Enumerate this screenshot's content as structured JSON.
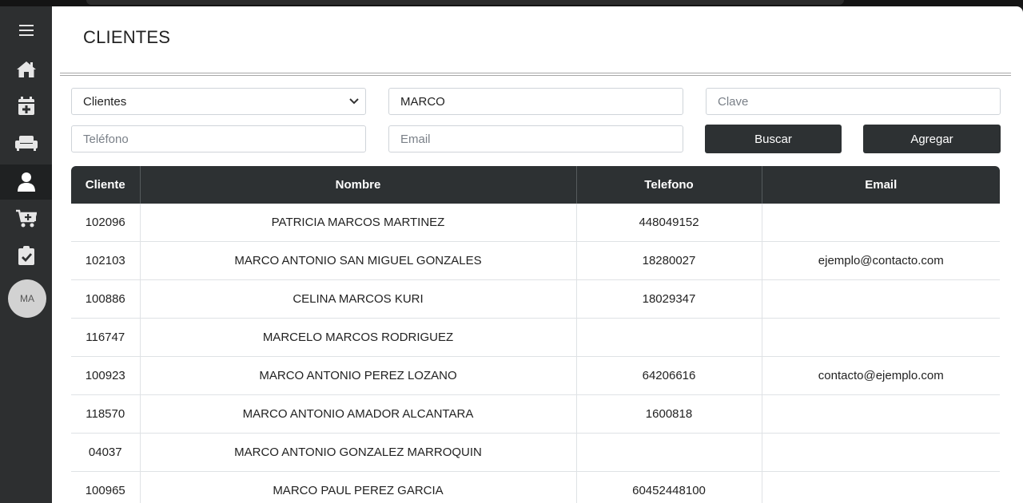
{
  "page": {
    "title": "CLIENTES"
  },
  "sidebar": {
    "items": [
      {
        "icon": "hamburger-menu-icon"
      },
      {
        "icon": "home-icon"
      },
      {
        "icon": "calendar-plus-icon"
      },
      {
        "icon": "couch-icon"
      },
      {
        "icon": "user-icon",
        "active": true
      },
      {
        "icon": "cart-plus-icon"
      },
      {
        "icon": "clipboard-check-icon"
      }
    ],
    "avatar_initials": "MA"
  },
  "filters": {
    "type_select": {
      "value": "Clientes",
      "options": [
        "Clientes"
      ]
    },
    "name_input": {
      "value": "MARCO"
    },
    "clave_input": {
      "placeholder": "Clave"
    },
    "phone_input": {
      "placeholder": "Teléfono"
    },
    "email_input": {
      "placeholder": "Email"
    },
    "search_label": "Buscar",
    "add_label": "Agregar"
  },
  "table": {
    "columns": [
      "Cliente",
      "Nombre",
      "Telefono",
      "Email"
    ],
    "rows": [
      [
        "102096",
        "PATRICIA MARCOS MARTINEZ",
        "448049152",
        ""
      ],
      [
        "102103",
        "MARCO ANTONIO SAN MIGUEL GONZALES",
        "18280027",
        "ejemplo@contacto.com"
      ],
      [
        "100886",
        "CELINA MARCOS KURI",
        "18029347",
        ""
      ],
      [
        "116747",
        "MARCELO MARCOS RODRIGUEZ",
        "",
        ""
      ],
      [
        "100923",
        "MARCO ANTONIO PEREZ LOZANO",
        "64206616",
        "contacto@ejemplo.com"
      ],
      [
        "118570",
        "MARCO ANTONIO AMADOR ALCANTARA",
        "1600818",
        ""
      ],
      [
        "04037",
        "MARCO ANTONIO GONZALEZ MARROQUIN",
        "",
        ""
      ],
      [
        "100965",
        "MARCO PAUL PEREZ GARCIA",
        "60452448100",
        ""
      ]
    ]
  },
  "colors": {
    "sidebar": "#2d2f30",
    "header_dark": "#2d3133",
    "background": "#ffffff"
  }
}
